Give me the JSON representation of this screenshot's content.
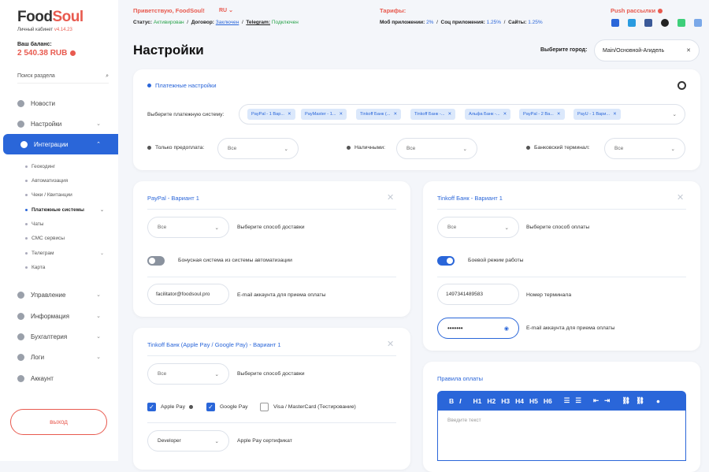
{
  "brand": {
    "food": "Food",
    "soul": "Soul",
    "cabinet": "Личный кабинет",
    "version": "v4.14.23"
  },
  "balance": {
    "label": "Ваш баланс:",
    "value": "2 540.38 RUB"
  },
  "search": {
    "placeholder": "Поиск раздела"
  },
  "nav": [
    {
      "label": "Новости",
      "icon": "news-icon"
    },
    {
      "label": "Настройки",
      "icon": "settings-icon"
    },
    {
      "label": "Интеграции",
      "icon": "integrations-icon"
    },
    {
      "label": "Управление",
      "icon": "management-icon"
    },
    {
      "label": "Информация",
      "icon": "info-icon"
    },
    {
      "label": "Бухгалтерия",
      "icon": "accounting-icon"
    },
    {
      "label": "Логи",
      "icon": "logs-icon"
    },
    {
      "label": "Аккаунт",
      "icon": "account-icon"
    }
  ],
  "subnav": [
    "Геокодинг",
    "Автоматизация",
    "Чеки / Квитанции",
    "Платежные системы",
    "Чаты",
    "СМС сервисы",
    "Телеграм",
    "Карта"
  ],
  "exit_label": "выход",
  "header": {
    "greeting": "Приветствую, FoodSoul!",
    "lang": "RU",
    "status_label": "Статус:",
    "status_value": "Активирован",
    "contract_label": "Договор:",
    "contract_value": "Заключен",
    "telegram_label": "Telegram:",
    "telegram_value": "Подключен",
    "tariffs": "Тарифы:",
    "mob_label": "Моб приложении:",
    "mob_value": "2%",
    "soc_label": "Соц приложения:",
    "soc_value": "1.25%",
    "sites_label": "Сайты:",
    "sites_value": "1.25%",
    "push": "Push рассылки"
  },
  "page_title": "Настройки",
  "city": {
    "label": "Выберите город:",
    "value": "Main/Основной-Агидель"
  },
  "payment": {
    "title": "Платежные настройки",
    "system_label": "Выберите платежную систему:",
    "chips": [
      "PayPal - 1 Вар...",
      "PayMaster - 1...",
      "Tinkoff Банк (...",
      "Tinkoff Банк -...",
      "Альфа Банк -...",
      "PayPal - 2 Ва...",
      "PayU - 1 Вари..."
    ],
    "prepay_label": "Только предоплата:",
    "prepay_value": "Все",
    "cash_label": "Наличными:",
    "cash_value": "Все",
    "terminal_label": "Банковский терминал:",
    "terminal_value": "Все"
  },
  "paypal": {
    "title": "PayPal - Вариант 1",
    "delivery_value": "Все",
    "delivery_label": "Выберите способ доставки",
    "bonus_label": "Бонусная система из системы автоматизации",
    "email_value": "facilitator@foodsoul.pro",
    "email_label": "E-mail аккаунта для приема оплаты"
  },
  "tinkoff": {
    "title": "Tinkoff Банк - Вариант 1",
    "payment_value": "Все",
    "payment_label": "Выберите способ оплаты",
    "mode_label": "Боевой режим работы",
    "terminal_value": "1497341489583",
    "terminal_label": "Номер терминала",
    "password_value": "•••••••",
    "email_label": "E-mail аккаунта для приема оплаты"
  },
  "tinkoff_apple": {
    "title": "Tinkoff Банк (Apple Pay / Google Pay) - Вариант 1",
    "delivery_value": "Все",
    "delivery_label": "Выберите способ доставки",
    "apple": "Apple Pay",
    "google": "Google Pay",
    "visa": "Visa / MasterCard (Тестирование)",
    "cert_value": "Developer",
    "cert_label": "Apple Pay сертификат"
  },
  "rules": {
    "title": "Правила оплаты",
    "toolbar": [
      "B",
      "I",
      "H1",
      "H2",
      "H3",
      "H4",
      "H5",
      "H6"
    ],
    "placeholder": "Введите текст"
  },
  "colors": {
    "accent": "#2a66d9",
    "brand": "#e85a4f",
    "success": "#29a34a"
  }
}
